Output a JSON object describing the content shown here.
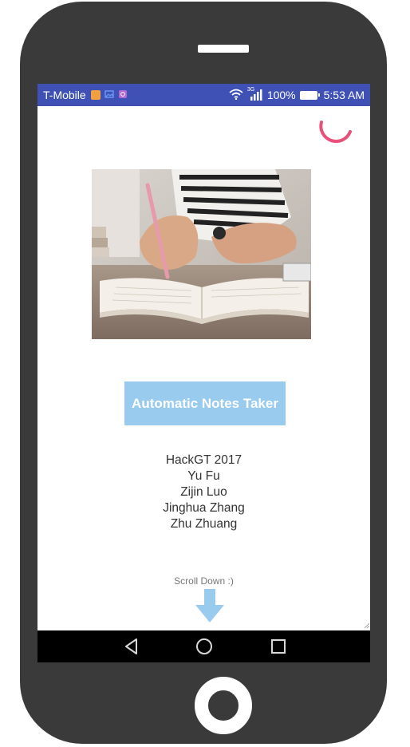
{
  "status_bar": {
    "carrier": "T-Mobile",
    "network_type": "3G",
    "battery": "100%",
    "time": "5:53 AM",
    "bar_color": "#3f51b5",
    "icons": [
      "notification-app-icon",
      "notification-image-icon",
      "notification-camera-icon",
      "wifi-icon",
      "signal-icon",
      "battery-icon"
    ]
  },
  "app": {
    "loading_spinner_color": "#e8507a",
    "title_button": "Automatic Notes Taker",
    "title_button_color": "#99cbef",
    "credits": [
      "HackGT 2017",
      "Yu Fu",
      "Zijin Luo",
      "Jinghua Zhang",
      "Zhu Zhuang"
    ],
    "scroll_hint": "Scroll Down :)",
    "scroll_arrow_color": "#99cbef"
  },
  "nav_bar": {
    "buttons": [
      "back-icon",
      "home-icon",
      "recents-icon"
    ]
  },
  "device": {
    "frame_color": "#3a3a3a"
  }
}
